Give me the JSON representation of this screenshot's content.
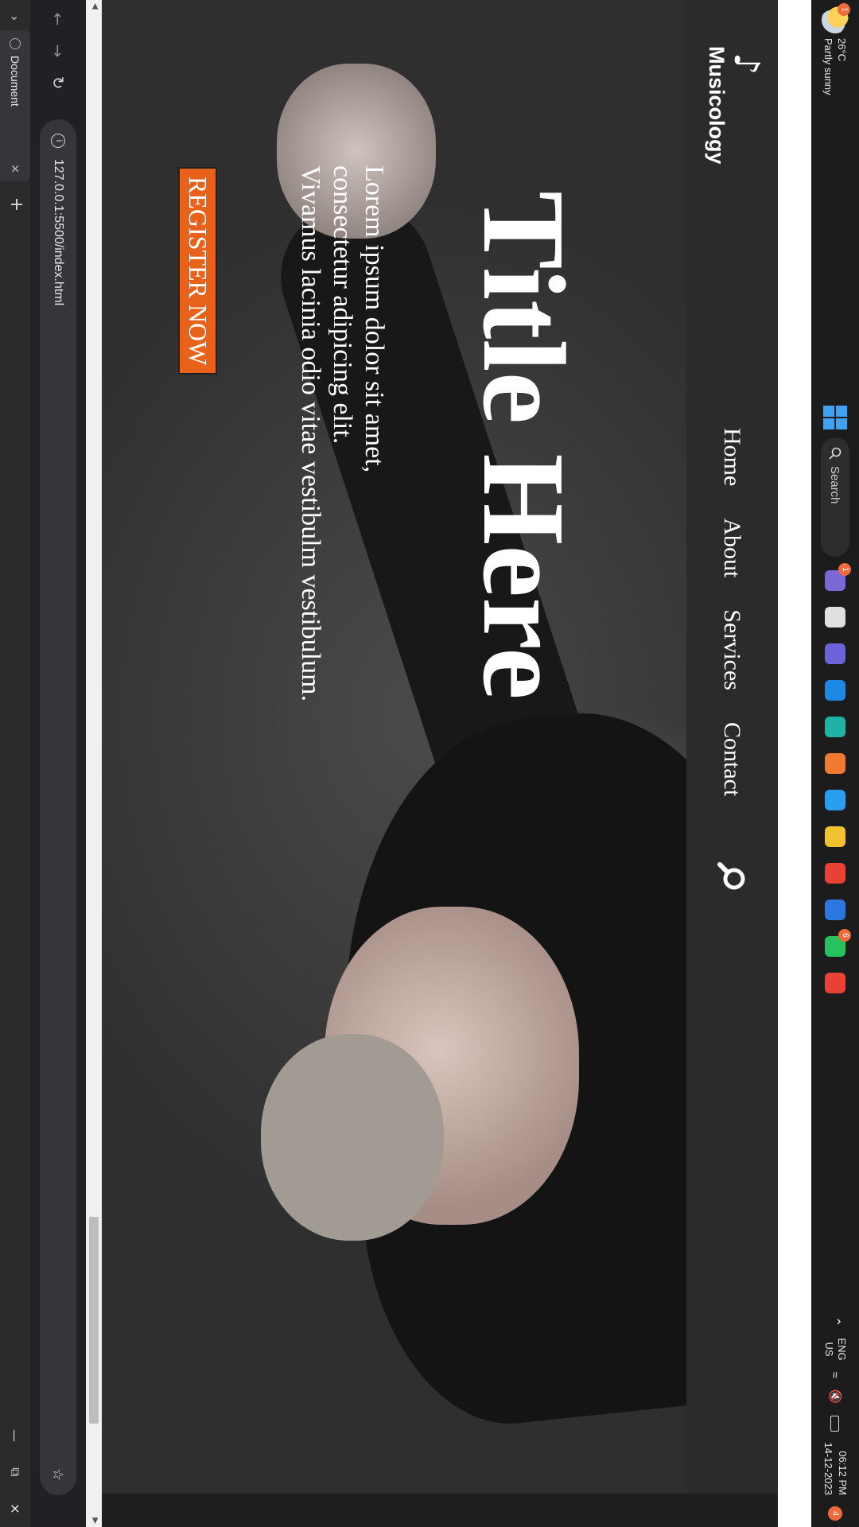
{
  "taskbar": {
    "weather": {
      "temp": "26°C",
      "condition": "Partly sunny",
      "badge": "1",
      "icon": "partly-sunny-icon"
    },
    "search_label": "Search",
    "apps": [
      {
        "name": "widgets",
        "color": "#7a67d8",
        "badge": "1"
      },
      {
        "name": "task-view",
        "color": "#e0e0e0"
      },
      {
        "name": "teams",
        "color": "#6b63d8"
      },
      {
        "name": "mail",
        "color": "#1e88e5"
      },
      {
        "name": "edge",
        "color": "#1fb3a8"
      },
      {
        "name": "xampp",
        "color": "#f07a30"
      },
      {
        "name": "vscode",
        "color": "#2a9ef0"
      },
      {
        "name": "file-explorer",
        "color": "#f2c230"
      },
      {
        "name": "chrome",
        "color": "#e94235"
      },
      {
        "name": "kanban",
        "color": "#2a77e0"
      },
      {
        "name": "whatsapp",
        "color": "#27c25e",
        "badge": "6"
      },
      {
        "name": "chrome-profile",
        "color": "#e94235"
      }
    ],
    "language": {
      "line1": "ENG",
      "line2": "US"
    },
    "time": "06:12 PM",
    "date": "14-12-2023",
    "notifications": "4"
  },
  "browser": {
    "tab_title": "Document",
    "url": "127.0.0.1:5500/index.html"
  },
  "site": {
    "logo_text": "Musicology",
    "nav": [
      "Home",
      "About",
      "Services",
      "Contact"
    ],
    "title": "Title Here",
    "description": [
      "Lorem ipsum dolor sit amet,",
      "consectetur adipicing elit.",
      "Vivamus lacinia odio vitae vestibulm vestibulum."
    ],
    "cta": "REGISTER NOW",
    "cta_color": "#e8621a"
  }
}
